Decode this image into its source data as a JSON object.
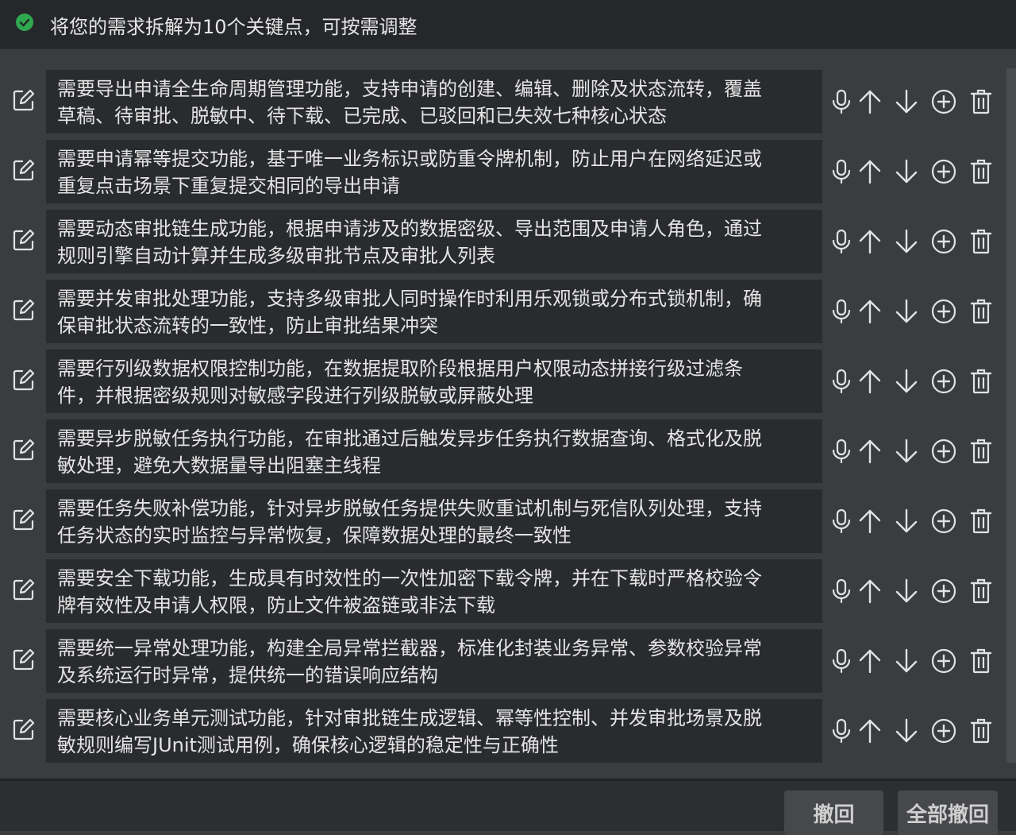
{
  "header": {
    "title": "将您的需求拆解为10个关键点，可按需调整"
  },
  "items": [
    {
      "line1": "需要导出申请全生命周期管理功能，支持申请的创建、编辑、删除及状态流转，覆盖",
      "line2": "草稿、待审批、脱敏中、待下载、已完成、已驳回和已失效七种核心状态"
    },
    {
      "line1": "需要申请幂等提交功能，基于唯一业务标识或防重令牌机制，防止用户在网络延迟或",
      "line2": "重复点击场景下重复提交相同的导出申请"
    },
    {
      "line1": "需要动态审批链生成功能，根据申请涉及的数据密级、导出范围及申请人角色，通过",
      "line2": "规则引擎自动计算并生成多级审批节点及审批人列表"
    },
    {
      "line1": "需要并发审批处理功能，支持多级审批人同时操作时利用乐观锁或分布式锁机制，确",
      "line2": "保审批状态流转的一致性，防止审批结果冲突"
    },
    {
      "line1": "需要行列级数据权限控制功能，在数据提取阶段根据用户权限动态拼接行级过滤条",
      "line2": "件，并根据密级规则对敏感字段进行列级脱敏或屏蔽处理"
    },
    {
      "line1": "需要异步脱敏任务执行功能，在审批通过后触发异步任务执行数据查询、格式化及脱",
      "line2": "敏处理，避免大数据量导出阻塞主线程"
    },
    {
      "line1": "需要任务失败补偿功能，针对异步脱敏任务提供失败重试机制与死信队列处理，支持",
      "line2": "任务状态的实时监控与异常恢复，保障数据处理的最终一致性"
    },
    {
      "line1": "需要安全下载功能，生成具有时效性的一次性加密下载令牌，并在下载时严格校验令",
      "line2": "牌有效性及申请人权限，防止文件被盗链或非法下载"
    },
    {
      "line1": "需要统一异常处理功能，构建全局异常拦截器，标准化封装业务异常、参数校验异常",
      "line2": "及系统运行时异常，提供统一的错误响应结构"
    },
    {
      "line1": "需要核心业务单元测试功能，针对审批链生成逻辑、幂等性控制、并发审批场景及脱",
      "line2": "敏规则编写JUnit测试用例，确保核心逻辑的稳定性与正确性"
    }
  ],
  "footer": {
    "undo_label": "撤回",
    "undo_all_label": "全部撤回"
  },
  "icons": {
    "header": "check-circle-icon",
    "edit": "edit-icon",
    "actions": [
      "microphone-icon",
      "arrow-up-icon",
      "arrow-down-icon",
      "plus-circle-icon",
      "trash-icon"
    ]
  },
  "colors": {
    "check": "#2fa84f",
    "bg": "#3a3d40",
    "item_bg": "#292b2e",
    "header_bg": "#25272a"
  }
}
